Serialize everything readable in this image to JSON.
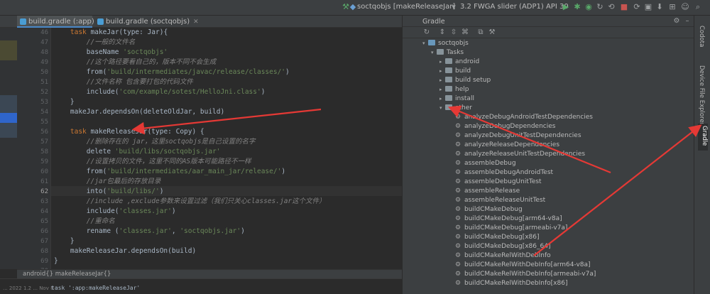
{
  "toolbar": {
    "run_config": "soctqobjs [makeReleaseJar]",
    "device_config": "3.2 FWGA slider (ADP1) API 30"
  },
  "tabs": [
    {
      "label": "build.gradle (:app)",
      "active": true
    },
    {
      "label": "build.gradle (soctqobjs)",
      "active": false
    }
  ],
  "editor": {
    "lines": [
      {
        "num": "46",
        "code": [
          {
            "t": "    ",
            "k": "pl"
          },
          {
            "t": "task ",
            "k": "kw"
          },
          {
            "t": "makeJar(type: Jar){",
            "k": "pl"
          }
        ]
      },
      {
        "num": "47",
        "code": [
          {
            "t": "        ",
            "k": "pl"
          },
          {
            "t": "//一般的文件名",
            "k": "cm"
          }
        ]
      },
      {
        "num": "48",
        "code": [
          {
            "t": "        baseName ",
            "k": "pl"
          },
          {
            "t": "'soctqobjs'",
            "k": "st"
          }
        ]
      },
      {
        "num": "49",
        "code": [
          {
            "t": "        ",
            "k": "pl"
          },
          {
            "t": "//这个路径要看自己的，版本不同不会生成",
            "k": "cm"
          }
        ]
      },
      {
        "num": "50",
        "code": [
          {
            "t": "        from(",
            "k": "pl"
          },
          {
            "t": "'build/intermediates/javac/release/classes/'",
            "k": "st"
          },
          {
            "t": ")",
            "k": "pl"
          }
        ]
      },
      {
        "num": "51",
        "code": [
          {
            "t": "        ",
            "k": "pl"
          },
          {
            "t": "//文件名称 包含要打包的代码文件",
            "k": "cm"
          }
        ]
      },
      {
        "num": "52",
        "code": [
          {
            "t": "        include(",
            "k": "pl"
          },
          {
            "t": "'com/example/sotest/HelloJni.class'",
            "k": "st"
          },
          {
            "t": ")",
            "k": "pl"
          }
        ]
      },
      {
        "num": "53",
        "code": [
          {
            "t": "    }",
            "k": "pl"
          }
        ]
      },
      {
        "num": "54",
        "code": [
          {
            "t": "    makeJar.dependsOn(deleteOldJar, build)",
            "k": "pl"
          }
        ]
      },
      {
        "num": "55",
        "code": [
          {
            "t": "",
            "k": "pl"
          }
        ]
      },
      {
        "num": "56",
        "code": [
          {
            "t": "    ",
            "k": "pl"
          },
          {
            "t": "task ",
            "k": "kw"
          },
          {
            "t": "makeReleaseJar(type: Copy) {",
            "k": "pl"
          }
        ]
      },
      {
        "num": "57",
        "code": [
          {
            "t": "        ",
            "k": "pl"
          },
          {
            "t": "//删除存在的 jar，这里soctqobjs是自己设置的名字",
            "k": "cm"
          }
        ]
      },
      {
        "num": "58",
        "code": [
          {
            "t": "        delete ",
            "k": "pl"
          },
          {
            "t": "'build/libs/soctqobjs.jar'",
            "k": "st"
          }
        ]
      },
      {
        "num": "59",
        "code": [
          {
            "t": "        ",
            "k": "pl"
          },
          {
            "t": "//设置拷贝的文件，这里不同的AS版本可能路径不一样",
            "k": "cm"
          }
        ]
      },
      {
        "num": "60",
        "code": [
          {
            "t": "        from(",
            "k": "pl"
          },
          {
            "t": "'build/intermediates/aar_main_jar/release/'",
            "k": "st"
          },
          {
            "t": ")",
            "k": "pl"
          }
        ]
      },
      {
        "num": "61",
        "code": [
          {
            "t": "        ",
            "k": "pl"
          },
          {
            "t": "//jar包最后的存放目录",
            "k": "cm"
          }
        ]
      },
      {
        "num": "62",
        "code": [
          {
            "t": "        into(",
            "k": "pl"
          },
          {
            "t": "'build/libs/'",
            "k": "st"
          },
          {
            "t": ")",
            "k": "pl"
          }
        ]
      },
      {
        "num": "63",
        "code": [
          {
            "t": "        ",
            "k": "pl"
          },
          {
            "t": "//include ,exclude参数来设置过滤（我们只关心classes.jar这个文件）",
            "k": "cm"
          }
        ]
      },
      {
        "num": "64",
        "code": [
          {
            "t": "        include(",
            "k": "pl"
          },
          {
            "t": "'classes.jar'",
            "k": "st"
          },
          {
            "t": ")",
            "k": "pl"
          }
        ]
      },
      {
        "num": "65",
        "code": [
          {
            "t": "        ",
            "k": "pl"
          },
          {
            "t": "//重命名",
            "k": "cm"
          }
        ]
      },
      {
        "num": "66",
        "code": [
          {
            "t": "        rename (",
            "k": "pl"
          },
          {
            "t": "'classes.jar'",
            "k": "st"
          },
          {
            "t": ", ",
            "k": "pl"
          },
          {
            "t": "'soctqobjs.jar'",
            "k": "st"
          },
          {
            "t": ")",
            "k": "pl"
          }
        ]
      },
      {
        "num": "67",
        "code": [
          {
            "t": "    }",
            "k": "pl"
          }
        ]
      },
      {
        "num": "68",
        "code": [
          {
            "t": "    makeReleaseJar.dependsOn(build)",
            "k": "pl"
          }
        ]
      },
      {
        "num": "69",
        "code": [
          {
            "t": "}",
            "k": "pl"
          }
        ]
      },
      {
        "num": "70",
        "code": [
          {
            "t": "",
            "k": "pl"
          }
        ]
      }
    ],
    "current_line": "62",
    "breadcrumb": "android{}  makeReleaseJar{}",
    "bottom_text": "task ':app:makeReleaseJar'",
    "bottom_side": "... 2022 1.2 ... Nov 8"
  },
  "gradle": {
    "title": "Gradle",
    "tree": [
      {
        "label": "soctqobjs",
        "level": 0,
        "kind": "module",
        "expanded": true
      },
      {
        "label": "Tasks",
        "level": 1,
        "kind": "folder",
        "expanded": true
      },
      {
        "label": "android",
        "level": 2,
        "kind": "folder",
        "expanded": false
      },
      {
        "label": "build",
        "level": 2,
        "kind": "folder",
        "expanded": false
      },
      {
        "label": "build setup",
        "level": 2,
        "kind": "folder",
        "expanded": false
      },
      {
        "label": "help",
        "level": 2,
        "kind": "folder",
        "expanded": false
      },
      {
        "label": "install",
        "level": 2,
        "kind": "folder",
        "expanded": false
      },
      {
        "label": "other",
        "level": 2,
        "kind": "folder",
        "expanded": true
      },
      {
        "label": "analyzeDebugAndroidTestDependencies",
        "level": 3,
        "kind": "task"
      },
      {
        "label": "analyzeDebugDependencies",
        "level": 3,
        "kind": "task"
      },
      {
        "label": "analyzeDebugUnitTestDependencies",
        "level": 3,
        "kind": "task"
      },
      {
        "label": "analyzeReleaseDependencies",
        "level": 3,
        "kind": "task"
      },
      {
        "label": "analyzeReleaseUnitTestDependencies",
        "level": 3,
        "kind": "task"
      },
      {
        "label": "assembleDebug",
        "level": 3,
        "kind": "task"
      },
      {
        "label": "assembleDebugAndroidTest",
        "level": 3,
        "kind": "task"
      },
      {
        "label": "assembleDebugUnitTest",
        "level": 3,
        "kind": "task"
      },
      {
        "label": "assembleRelease",
        "level": 3,
        "kind": "task"
      },
      {
        "label": "assembleReleaseUnitTest",
        "level": 3,
        "kind": "task"
      },
      {
        "label": "buildCMakeDebug",
        "level": 3,
        "kind": "task"
      },
      {
        "label": "buildCMakeDebug[arm64-v8a]",
        "level": 3,
        "kind": "task"
      },
      {
        "label": "buildCMakeDebug[armeabi-v7a]",
        "level": 3,
        "kind": "task"
      },
      {
        "label": "buildCMakeDebug[x86]",
        "level": 3,
        "kind": "task"
      },
      {
        "label": "buildCMakeDebug[x86_64]",
        "level": 3,
        "kind": "task"
      },
      {
        "label": "buildCMakeRelWithDebInfo",
        "level": 3,
        "kind": "task"
      },
      {
        "label": "buildCMakeRelWithDebInfo[arm64-v8a]",
        "level": 3,
        "kind": "task"
      },
      {
        "label": "buildCMakeRelWithDebInfo[armeabi-v7a]",
        "level": 3,
        "kind": "task"
      },
      {
        "label": "buildCMakeRelWithDebInfo[x86]",
        "level": 3,
        "kind": "task"
      }
    ]
  },
  "right_strip": {
    "items": [
      {
        "label": "Codota",
        "active": false
      },
      {
        "label": "Device File Explorer",
        "active": false
      },
      {
        "label": "Gradle",
        "active": true
      }
    ]
  },
  "colors": {
    "keyword": "#cc7832",
    "comment": "#808080",
    "string": "#6a8759",
    "plain": "#a9b7c6",
    "annotation": "#e53935"
  }
}
